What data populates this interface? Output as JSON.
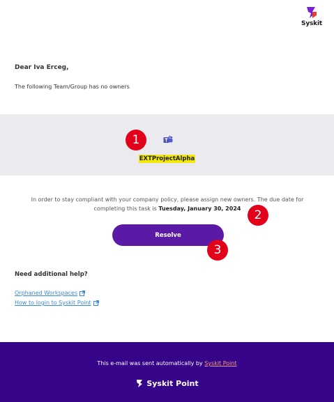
{
  "header": {
    "logo_text": "Syskit"
  },
  "body": {
    "greeting": "Dear Iva Erceg,",
    "intro": "The following Team/Group has no owners"
  },
  "group": {
    "name": "EXTProjectAlpha",
    "icon": "teams-icon"
  },
  "policy": {
    "text": "In order to stay compliant with your company policy, please assign new owners. The due date for completing this task is ",
    "due_date": "Tuesday, January 30, 2024"
  },
  "actions": {
    "resolve_label": "Resolve"
  },
  "help": {
    "title": "Need additional help?",
    "links": [
      {
        "label": "Orphaned Workspaces"
      },
      {
        "label": "How to login to Syskit Point"
      }
    ]
  },
  "footer": {
    "note_prefix": "This e-mail was sent automatically by ",
    "note_link": "Syskit Point",
    "brand": "Syskit Point"
  },
  "markers": [
    "1",
    "2",
    "3"
  ],
  "colors": {
    "accent": "#5b1aa6",
    "footer_bg": "#350489",
    "band_bg": "#ebebef",
    "highlight": "#f4e70a",
    "marker": "#e3001b",
    "link": "#3a8bd6"
  }
}
